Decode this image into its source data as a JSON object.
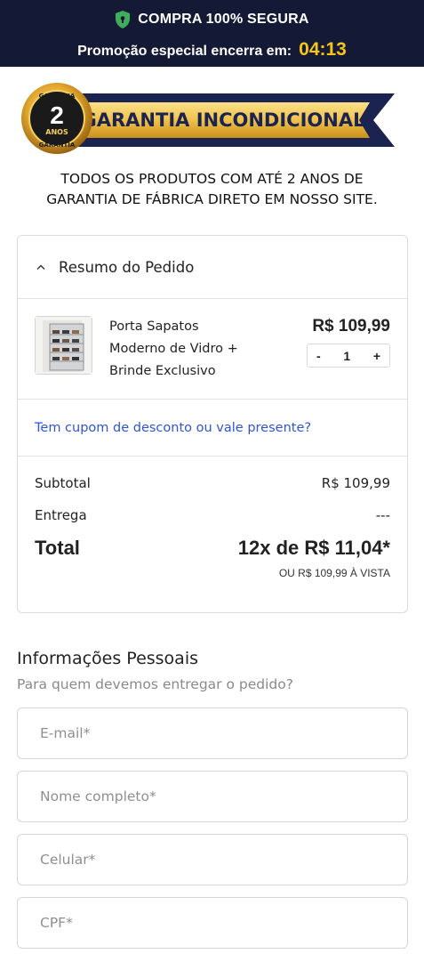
{
  "topbar": {
    "secure_label": "COMPRA 100% SEGURA",
    "promo_label": "Promoção especial encerra em:",
    "timer": "04:13"
  },
  "banner": {
    "badge_top": "GARANTIA",
    "badge_years": "2",
    "badge_anos": "ANOS",
    "badge_bottom": "GARANTIA",
    "ribbon_text": "GARANTIA INCONDICIONAL",
    "subtitle_line1": "TODOS OS PRODUTOS COM ATÉ 2 ANOS DE",
    "subtitle_line2": "GARANTIA DE FÁBRICA DIRETO EM NOSSO SITE."
  },
  "order": {
    "title": "Resumo do Pedido",
    "product": {
      "name_line1": "Porta Sapatos",
      "name_line2": "Moderno de Vidro +",
      "name_line3": "Brinde Exclusivo",
      "price": "R$ 109,99",
      "qty_minus": "-",
      "qty": "1",
      "qty_plus": "+"
    },
    "coupon_link": "Tem cupom de desconto ou vale presente?",
    "subtotal_label": "Subtotal",
    "subtotal_value": "R$ 109,99",
    "shipping_label": "Entrega",
    "shipping_value": "---",
    "total_label": "Total",
    "total_value": "12x de R$ 11,04*",
    "cash_note": "OU R$ 109,99 À VISTA"
  },
  "personal": {
    "title": "Informações Pessoais",
    "subtitle": "Para quem devemos entregar o pedido?",
    "email_placeholder": "E-mail*",
    "name_placeholder": "Nome completo*",
    "phone_placeholder": "Celular*",
    "cpf_placeholder": "CPF*"
  },
  "colors": {
    "topbar_bg": "#141a35",
    "timer": "#f5c518",
    "shield": "#3fae5a",
    "link": "#2f55d4",
    "ribbon_gold": "#f2c84b",
    "ribbon_navy": "#1b2450"
  }
}
